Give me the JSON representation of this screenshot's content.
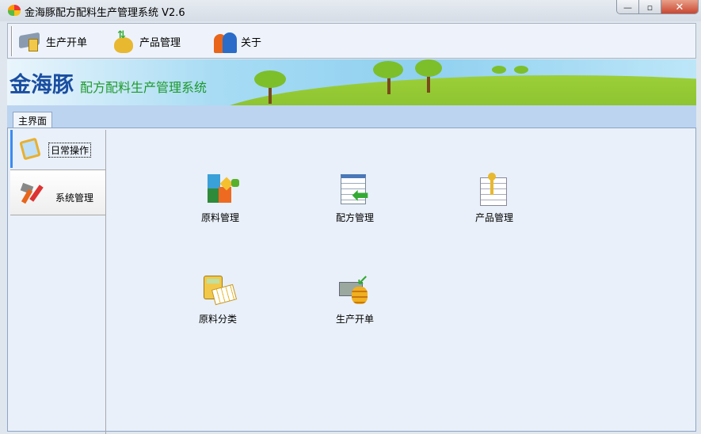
{
  "window": {
    "title": "金海豚配方配料生产管理系统 V2.6",
    "minimize": "—",
    "maximize": "▫",
    "close": "✕"
  },
  "toolbar": {
    "items": [
      {
        "label": "生产开单",
        "icon": "cash-register-icon"
      },
      {
        "label": "产品管理",
        "icon": "money-bag-icon"
      },
      {
        "label": "关于",
        "icon": "users-icon"
      }
    ]
  },
  "banner": {
    "brand": "金海豚",
    "subtitle": "配方配料生产管理系统"
  },
  "tabs": [
    {
      "label": "主界面"
    }
  ],
  "sidebar": {
    "items": [
      {
        "label": "日常操作",
        "icon": "clipboard-icon"
      },
      {
        "label": "系统管理",
        "icon": "tools-icon"
      }
    ]
  },
  "functions": [
    {
      "label": "原料管理",
      "icon": "blocks-icon"
    },
    {
      "label": "配方管理",
      "icon": "calendar-arrow-icon"
    },
    {
      "label": "产品管理",
      "icon": "key-document-icon"
    },
    {
      "label": "原料分类",
      "icon": "calculator-icon"
    },
    {
      "label": "生产开单",
      "icon": "money-coins-icon"
    }
  ]
}
